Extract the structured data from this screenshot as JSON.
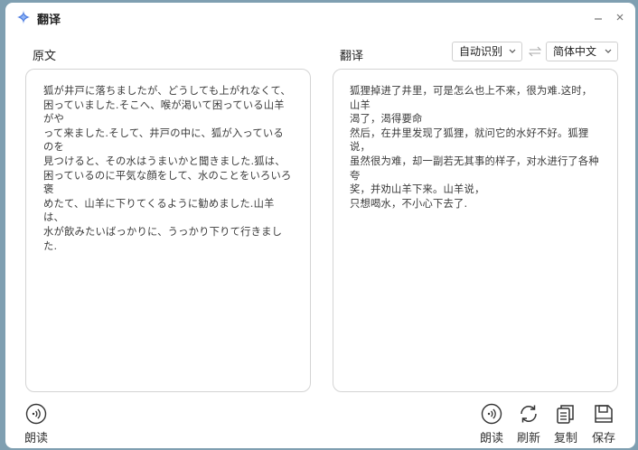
{
  "window": {
    "title": "翻译",
    "minimize_icon": "minimize-icon",
    "close_icon": "close-icon"
  },
  "colors": {
    "icon_blue": "#4a7ae0",
    "border": "#d4d4d4",
    "text": "#333333"
  },
  "source": {
    "label": "原文",
    "text": "狐が井戸に落ちましたが、どうしても上がれなくて、\n困っていました.そこへ、喉が渇いて困っている山羊がや\nって来ました.そして、井戸の中に、狐が入っているのを\n見つけると、その水はうまいかと聞きました.狐は、\n困っているのに平気な顔をして、水のことをいろいろ褒\nめたて、山羊に下りてくるように勧めました.山羊は、\n水が飲みたいばっかりに、うっかり下りて行きました."
  },
  "target": {
    "label": "翻译",
    "text": "狐狸掉进了井里，可是怎么也上不来，很为难.这时，山羊\n渴了，渴得要命\n然后，在井里发现了狐狸，就问它的水好不好。狐狸说，\n虽然很为难，却一副若无其事的样子，对水进行了各种夸\n奖，并劝山羊下来。山羊说，\n只想喝水，不小心下去了."
  },
  "languages": {
    "source": "自动识别",
    "target": "简体中文"
  },
  "toolbar": {
    "read_source": "朗读",
    "read_target": "朗读",
    "refresh": "刷新",
    "copy": "复制",
    "save": "保存"
  }
}
